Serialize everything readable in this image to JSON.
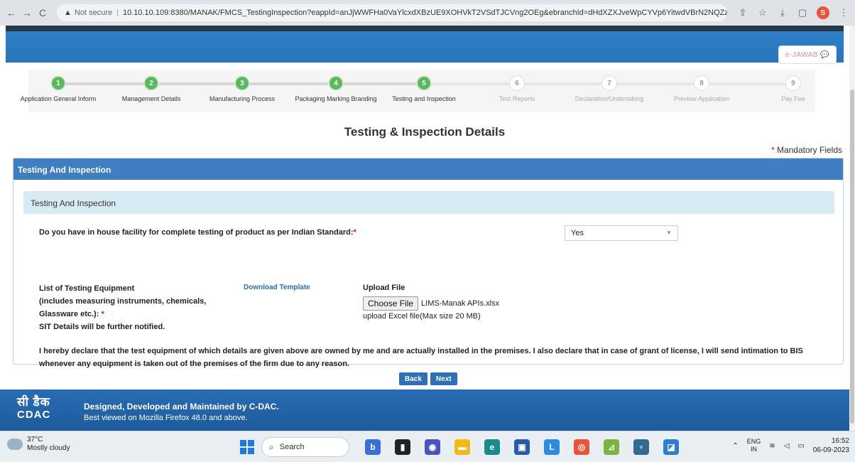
{
  "browser": {
    "back_icon": "←",
    "forward_icon": "→",
    "reload_icon": "C",
    "warning_icon": "▲",
    "security_text": "Not secure",
    "url": "10.10.10.109:8380/MANAK/FMCS_TestingInspection?eappId=anJjWWFHa0VaYlcxdXBzUE9XOHVkT2VSdTJCVng2OEg&ebranchId=dHdXZXJveWpCYVp6YitwdVBrN2NQZz09",
    "profile_letter": "S"
  },
  "header": {
    "ejawab_label": "e-JAWAB"
  },
  "stepper": {
    "steps": [
      {
        "num": "1",
        "label": "Application General Inform",
        "state": "done"
      },
      {
        "num": "2",
        "label": "Management Details",
        "state": "done"
      },
      {
        "num": "3",
        "label": "Manufacturing Process",
        "state": "done"
      },
      {
        "num": "4",
        "label": "Packaging Marking Branding",
        "state": "done"
      },
      {
        "num": "5",
        "label": "Testing and Inspection",
        "state": "done"
      },
      {
        "num": "6",
        "label": "Test Reports",
        "state": "todo"
      },
      {
        "num": "7",
        "label": "Declaration/Undertaking",
        "state": "todo"
      },
      {
        "num": "8",
        "label": "Preview Application",
        "state": "todo"
      },
      {
        "num": "9",
        "label": "Pay Fee",
        "state": "todo"
      }
    ]
  },
  "page": {
    "title": "Testing & Inspection Details",
    "mandatory_star": "*",
    "mandatory_text": "Mandatory Fields"
  },
  "panel": {
    "heading": "Testing And Inspection",
    "inner_heading": "Testing And Inspection",
    "question": "Do you have in house facility for complete testing of product as per Indian Standard:",
    "required_star": "*",
    "select_value": "Yes",
    "equipment_line1": "List of Testing Equipment",
    "equipment_line2": "(includes measuring instruments, chemicals,",
    "equipment_line3": "Glassware etc.):",
    "equipment_line4": "SIT Details will be further notified.",
    "download_template": "Download Template",
    "upload_label": "Upload File",
    "choose_file": "Choose File",
    "file_name": "LIMS-Manak APIs.xlsx",
    "upload_hint": "upload Excel file(Max size 20 MB)",
    "declaration": "I hereby declare that the test equipment of which details are given above are owned by me and are actually installed in the premises. I also declare that in case of grant of license, I will send intimation to BIS whenever any equipment is taken out of the premises of the firm due to any reason."
  },
  "buttons": {
    "back": "Back",
    "next": "Next"
  },
  "footer": {
    "logo_hindi": "सी डैक",
    "logo_en": "CDAC",
    "line1": "Designed, Developed and Maintained by C-DAC.",
    "line2": "Best viewed on Mozilla Firefox 48.0 and above."
  },
  "taskbar": {
    "temp": "37°C",
    "weather": "Mostly cloudy",
    "search": "Search",
    "lang1": "ENG",
    "lang2": "IN",
    "time": "16:52",
    "date": "06-09-2023"
  }
}
